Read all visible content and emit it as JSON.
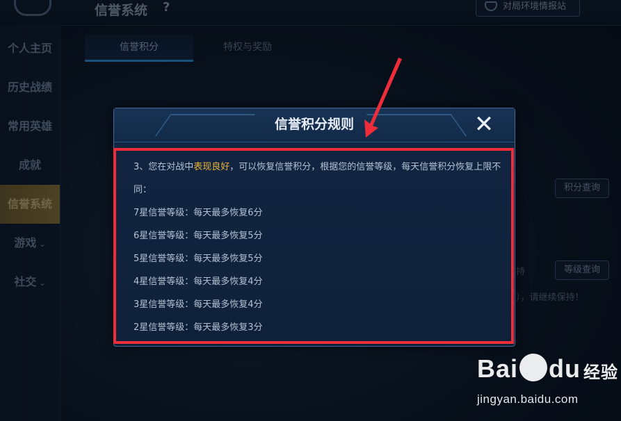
{
  "background": {
    "top_title": "信誉系统",
    "top_help": "?",
    "intel_button": "对局环境情报站",
    "sidebar": [
      {
        "label": "个人主页",
        "active": false,
        "chevron": false
      },
      {
        "label": "历史战绩",
        "active": false,
        "chevron": false
      },
      {
        "label": "常用英雄",
        "active": false,
        "chevron": false
      },
      {
        "label": "成就",
        "active": false,
        "chevron": false
      },
      {
        "label": "信誉系统",
        "active": true,
        "chevron": false
      },
      {
        "label": "游戏",
        "active": false,
        "chevron": true
      },
      {
        "label": "社交",
        "active": false,
        "chevron": true
      }
    ],
    "tabs": [
      {
        "label": "信誉积分",
        "active": true
      },
      {
        "label": "特权与奖励",
        "active": false
      }
    ],
    "score_query_button": "积分查询",
    "level_query_button": "等级查询",
    "partial_text_1": "持",
    "partial_text_2": "），请继续保持！"
  },
  "modal": {
    "title": "信誉积分规则",
    "close_label": "✕",
    "rule_intro_before": "3、您在对战中",
    "rule_intro_highlight": "表现良好",
    "rule_intro_after": "，可以恢复信誉积分，根据您的信誉等级，每天信誉积分恢复上限不同：",
    "levels": [
      "7星信誉等级：每天最多恢复6分",
      "6星信誉等级：每天最多恢复5分",
      "5星信誉等级：每天最多恢复5分",
      "4星信誉等级：每天最多恢复4分",
      "3星信誉等级：每天最多恢复4分",
      "2星信誉等级：每天最多恢复3分"
    ]
  },
  "watermark": {
    "logo_a": "Bai",
    "logo_b": "du",
    "logo_c": "经验",
    "url": "jingyan.baidu.com"
  },
  "colors": {
    "highlight": "#e8b23a",
    "annotation_red": "#ee2d3a",
    "active_tab_underline": "#2b8fd6"
  }
}
